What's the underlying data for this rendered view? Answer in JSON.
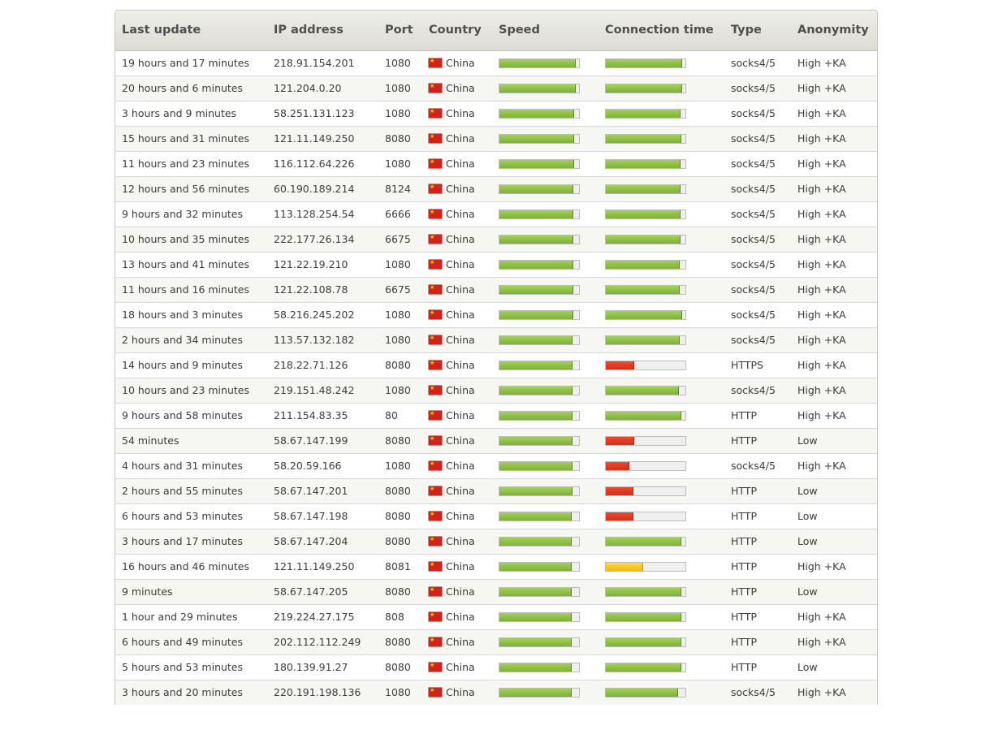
{
  "columns": [
    "Last update",
    "IP address",
    "Port",
    "Country",
    "Speed",
    "Connection time",
    "Type",
    "Anonymity"
  ],
  "status_colors": {
    "fast": "#8bc34a",
    "slow": "#e03a22",
    "medium": "#f7c325"
  },
  "rows": [
    {
      "update": "19 hours and 17 minutes",
      "ip": "218.91.154.201",
      "port": "1080",
      "country": "China",
      "speed": 0.95,
      "conn": 0.95,
      "conn_level": "fast",
      "type": "socks4/5",
      "anon": "High +KA"
    },
    {
      "update": "20 hours and 6 minutes",
      "ip": "121.204.0.20",
      "port": "1080",
      "country": "China",
      "speed": 0.95,
      "conn": 0.95,
      "conn_level": "fast",
      "type": "socks4/5",
      "anon": "High +KA"
    },
    {
      "update": "3 hours and 9 minutes",
      "ip": "58.251.131.123",
      "port": "1080",
      "country": "China",
      "speed": 0.93,
      "conn": 0.93,
      "conn_level": "fast",
      "type": "socks4/5",
      "anon": "High +KA"
    },
    {
      "update": "15 hours and 31 minutes",
      "ip": "121.11.149.250",
      "port": "8080",
      "country": "China",
      "speed": 0.93,
      "conn": 0.94,
      "conn_level": "fast",
      "type": "socks4/5",
      "anon": "High +KA"
    },
    {
      "update": "11 hours and 23 minutes",
      "ip": "116.112.64.226",
      "port": "1080",
      "country": "China",
      "speed": 0.93,
      "conn": 0.93,
      "conn_level": "fast",
      "type": "socks4/5",
      "anon": "High +KA"
    },
    {
      "update": "12 hours and 56 minutes",
      "ip": "60.190.189.214",
      "port": "8124",
      "country": "China",
      "speed": 0.92,
      "conn": 0.93,
      "conn_level": "fast",
      "type": "socks4/5",
      "anon": "High +KA"
    },
    {
      "update": "9 hours and 32 minutes",
      "ip": "113.128.254.54",
      "port": "6666",
      "country": "China",
      "speed": 0.92,
      "conn": 0.93,
      "conn_level": "fast",
      "type": "socks4/5",
      "anon": "High +KA"
    },
    {
      "update": "10 hours and 35 minutes",
      "ip": "222.177.26.134",
      "port": "6675",
      "country": "China",
      "speed": 0.92,
      "conn": 0.93,
      "conn_level": "fast",
      "type": "socks4/5",
      "anon": "High +KA"
    },
    {
      "update": "13 hours and 41 minutes",
      "ip": "121.22.19.210",
      "port": "1080",
      "country": "China",
      "speed": 0.92,
      "conn": 0.92,
      "conn_level": "fast",
      "type": "socks4/5",
      "anon": "High +KA"
    },
    {
      "update": "11 hours and 16 minutes",
      "ip": "121.22.108.78",
      "port": "6675",
      "country": "China",
      "speed": 0.92,
      "conn": 0.92,
      "conn_level": "fast",
      "type": "socks4/5",
      "anon": "High +KA"
    },
    {
      "update": "18 hours and 3 minutes",
      "ip": "58.216.245.202",
      "port": "1080",
      "country": "China",
      "speed": 0.92,
      "conn": 0.95,
      "conn_level": "fast",
      "type": "socks4/5",
      "anon": "High +KA"
    },
    {
      "update": "2 hours and 34 minutes",
      "ip": "113.57.132.182",
      "port": "1080",
      "country": "China",
      "speed": 0.91,
      "conn": 0.92,
      "conn_level": "fast",
      "type": "socks4/5",
      "anon": "High +KA"
    },
    {
      "update": "14 hours and 9 minutes",
      "ip": "218.22.71.126",
      "port": "8080",
      "country": "China",
      "speed": 0.91,
      "conn": 0.35,
      "conn_level": "slow",
      "type": "HTTPS",
      "anon": "High +KA"
    },
    {
      "update": "10 hours and 23 minutes",
      "ip": "219.151.48.242",
      "port": "1080",
      "country": "China",
      "speed": 0.91,
      "conn": 0.91,
      "conn_level": "fast",
      "type": "socks4/5",
      "anon": "High +KA"
    },
    {
      "update": "9 hours and 58 minutes",
      "ip": "211.154.83.35",
      "port": "80",
      "country": "China",
      "speed": 0.91,
      "conn": 0.94,
      "conn_level": "fast",
      "type": "HTTP",
      "anon": "High +KA"
    },
    {
      "update": "54 minutes",
      "ip": "58.67.147.199",
      "port": "8080",
      "country": "China",
      "speed": 0.91,
      "conn": 0.35,
      "conn_level": "slow",
      "type": "HTTP",
      "anon": "Low"
    },
    {
      "update": "4 hours and 31 minutes",
      "ip": "58.20.59.166",
      "port": "1080",
      "country": "China",
      "speed": 0.91,
      "conn": 0.29,
      "conn_level": "slow",
      "type": "socks4/5",
      "anon": "High +KA"
    },
    {
      "update": "2 hours and 55 minutes",
      "ip": "58.67.147.201",
      "port": "8080",
      "country": "China",
      "speed": 0.91,
      "conn": 0.34,
      "conn_level": "slow",
      "type": "HTTP",
      "anon": "Low"
    },
    {
      "update": "6 hours and 53 minutes",
      "ip": "58.67.147.198",
      "port": "8080",
      "country": "China",
      "speed": 0.9,
      "conn": 0.34,
      "conn_level": "slow",
      "type": "HTTP",
      "anon": "Low"
    },
    {
      "update": "3 hours and 17 minutes",
      "ip": "58.67.147.204",
      "port": "8080",
      "country": "China",
      "speed": 0.9,
      "conn": 0.94,
      "conn_level": "fast",
      "type": "HTTP",
      "anon": "Low"
    },
    {
      "update": "16 hours and 46 minutes",
      "ip": "121.11.149.250",
      "port": "8081",
      "country": "China",
      "speed": 0.9,
      "conn": 0.46,
      "conn_level": "medium",
      "type": "HTTP",
      "anon": "High +KA"
    },
    {
      "update": "9 minutes",
      "ip": "58.67.147.205",
      "port": "8080",
      "country": "China",
      "speed": 0.9,
      "conn": 0.94,
      "conn_level": "fast",
      "type": "HTTP",
      "anon": "Low"
    },
    {
      "update": "1 hour and 29 minutes",
      "ip": "219.224.27.175",
      "port": "808",
      "country": "China",
      "speed": 0.9,
      "conn": 0.94,
      "conn_level": "fast",
      "type": "HTTP",
      "anon": "High +KA"
    },
    {
      "update": "6 hours and 49 minutes",
      "ip": "202.112.112.249",
      "port": "8080",
      "country": "China",
      "speed": 0.9,
      "conn": 0.94,
      "conn_level": "fast",
      "type": "HTTP",
      "anon": "High +KA"
    },
    {
      "update": "5 hours and 53 minutes",
      "ip": "180.139.91.27",
      "port": "8080",
      "country": "China",
      "speed": 0.9,
      "conn": 0.94,
      "conn_level": "fast",
      "type": "HTTP",
      "anon": "Low"
    },
    {
      "update": "3 hours and 20 minutes",
      "ip": "220.191.198.136",
      "port": "1080",
      "country": "China",
      "speed": 0.9,
      "conn": 0.9,
      "conn_level": "fast",
      "type": "socks4/5",
      "anon": "High +KA"
    }
  ]
}
